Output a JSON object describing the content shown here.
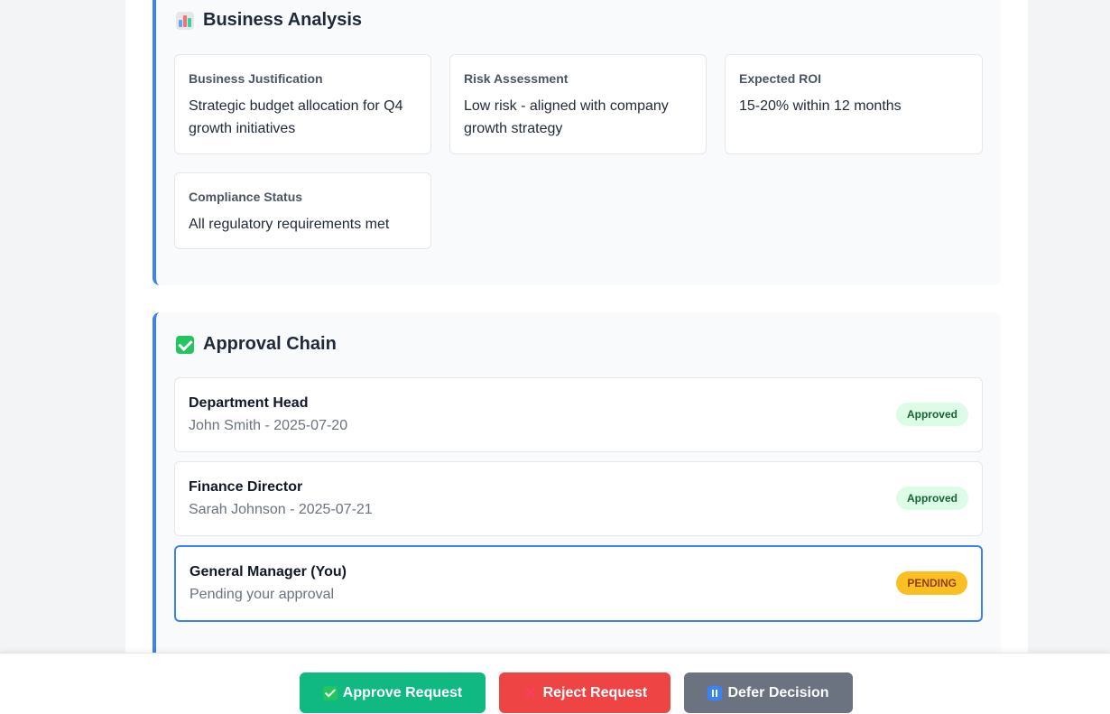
{
  "business_analysis": {
    "title": "Business Analysis",
    "icon": "bar-chart-icon",
    "cards": [
      {
        "label": "Business Justification",
        "value": "Strategic budget allocation for Q4 growth initiatives"
      },
      {
        "label": "Risk Assessment",
        "value": "Low risk - aligned with company growth strategy"
      },
      {
        "label": "Expected ROI",
        "value": "15-20% within 12 months"
      },
      {
        "label": "Compliance Status",
        "value": "All regulatory requirements met"
      }
    ]
  },
  "approval_chain": {
    "title": "Approval Chain",
    "icon": "check-box-icon",
    "items": [
      {
        "role": "Department Head",
        "detail": "John Smith - 2025-07-20",
        "status": "Approved"
      },
      {
        "role": "Finance Director",
        "detail": "Sarah Johnson - 2025-07-21",
        "status": "Approved"
      },
      {
        "role": "General Manager (You)",
        "detail": "Pending your approval",
        "status": "PENDING"
      }
    ]
  },
  "actions": {
    "approve_label": "Approve Request",
    "reject_label": "Reject Request",
    "defer_label": "Defer Decision"
  },
  "colors": {
    "accent": "#3b82f6",
    "approve": "#10b981",
    "reject": "#ef4444",
    "defer": "#6b7280",
    "approved_badge_bg": "#dcfce7",
    "pending_badge_bg": "#fbbf24"
  }
}
